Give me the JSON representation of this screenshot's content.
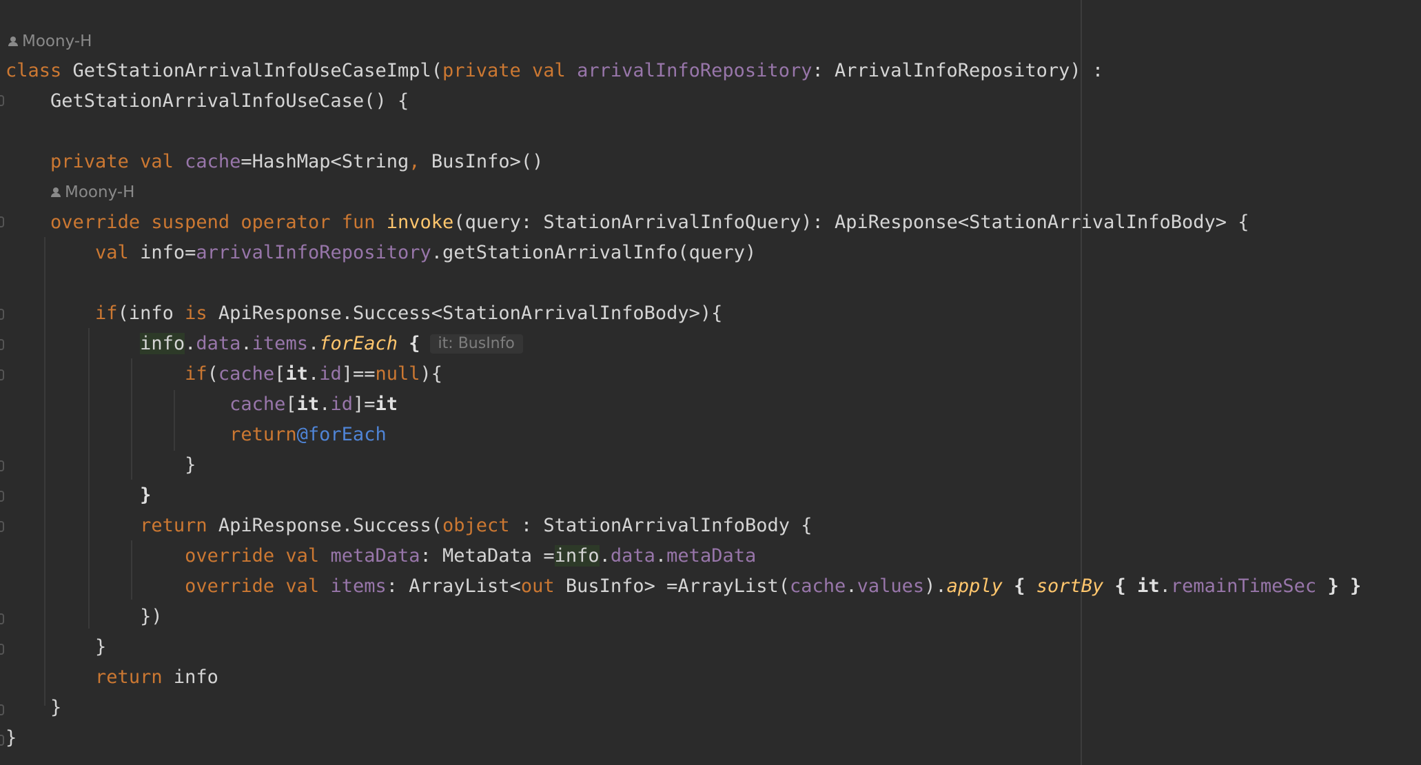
{
  "editor": {
    "author_hints": [
      "Moony-H",
      "Moony-H"
    ],
    "tokens": {
      "class": "class",
      "class_name": "GetStationArrivalInfoUseCaseImpl",
      "private": "private",
      "val": "val",
      "repo_param": "arrivalInfoRepository",
      "repo_type": "ArrivalInfoRepository",
      "super_type": "GetStationArrivalInfoUseCase",
      "cache": "cache",
      "hashmap": "HashMap",
      "string": "String",
      "businfo": "BusInfo",
      "override": "override",
      "suspend": "suspend",
      "operator": "operator",
      "fun": "fun",
      "invoke": "invoke",
      "query": "query",
      "query_type": "StationArrivalInfoQuery",
      "api_response": "ApiResponse",
      "body_type": "StationArrivalInfoBody",
      "info": "info",
      "get_info": "getStationArrivalInfo",
      "if": "if",
      "is": "is",
      "success": "Success",
      "data": "data",
      "items": "items",
      "for_each": "forEach",
      "param_hint": "it: BusInfo",
      "it": "it",
      "id": "id",
      "null": "null",
      "return": "return",
      "return_label": "@forEach",
      "object": "object",
      "meta_data": "metaData",
      "meta_type": "MetaData",
      "array_list": "ArrayList",
      "out": "out",
      "values": "values",
      "apply": "apply",
      "sort_by": "sortBy",
      "remain_time_sec": "remainTimeSec"
    }
  }
}
